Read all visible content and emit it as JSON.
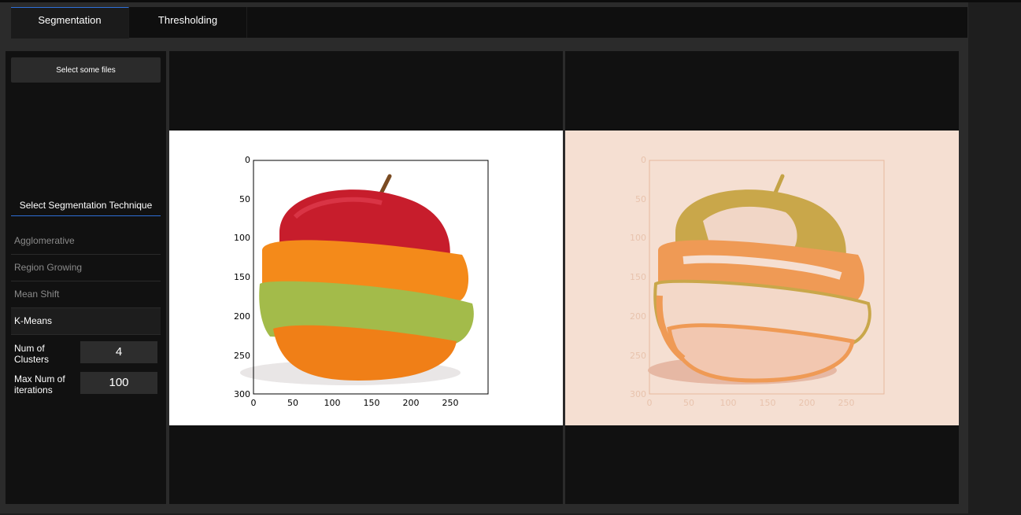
{
  "tabs": [
    {
      "label": "Segmentation",
      "active": true
    },
    {
      "label": "Thresholding",
      "active": false
    }
  ],
  "sidebar": {
    "select_button_label": "Select some files",
    "technique_title": "Select Segmentation Technique",
    "techniques": [
      {
        "label": "Agglomerative"
      },
      {
        "label": "Region Growing"
      },
      {
        "label": "Mean Shift"
      },
      {
        "label": "K-Means"
      }
    ],
    "active_technique": "K-Means",
    "params": {
      "clusters_label": "Num of Clusters",
      "clusters_value": "4",
      "iterations_label": "Max Num of iterations",
      "iterations_value": "100"
    }
  },
  "plots": {
    "x_ticks": [
      "0",
      "50",
      "100",
      "150",
      "200",
      "250"
    ],
    "y_ticks": [
      "0",
      "50",
      "100",
      "150",
      "200",
      "250",
      "300"
    ]
  },
  "colors": {
    "accent": "#2e6fd8",
    "segmented_background": "#f5dfd2"
  }
}
